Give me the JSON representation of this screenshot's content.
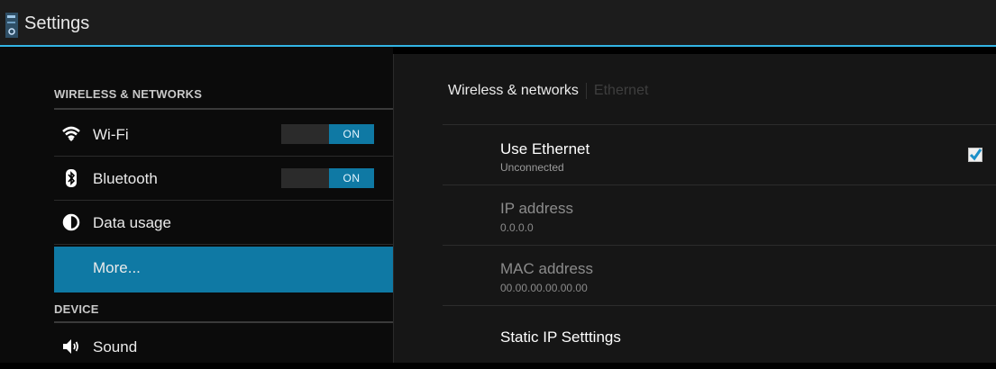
{
  "actionbar": {
    "title": "Settings"
  },
  "left": {
    "sections": [
      {
        "header": "WIRELESS & NETWORKS"
      },
      {
        "header": "DEVICE"
      }
    ],
    "items": [
      {
        "label": "Wi-Fi",
        "icon": "wifi-icon",
        "toggle": "ON"
      },
      {
        "label": "Bluetooth",
        "icon": "bluetooth-icon",
        "toggle": "ON"
      },
      {
        "label": "Data usage",
        "icon": "data-usage-icon"
      },
      {
        "label": "More...",
        "icon": "",
        "selected": true
      },
      {
        "label": "Sound",
        "icon": "sound-icon"
      }
    ]
  },
  "right": {
    "breadcrumb": {
      "current": "Wireless & networks",
      "next": "Ethernet"
    },
    "rows": [
      {
        "title": "Use Ethernet",
        "summary": "Unconnected",
        "checked": true
      },
      {
        "title": "IP address",
        "summary": "0.0.0.0"
      },
      {
        "title": "MAC address",
        "summary": "00.00.00.00.00.00"
      },
      {
        "title": "Static IP Setttings"
      }
    ]
  },
  "colors": {
    "accent": "#33b5e5",
    "selected": "#0f79a4",
    "background": "#000000"
  }
}
